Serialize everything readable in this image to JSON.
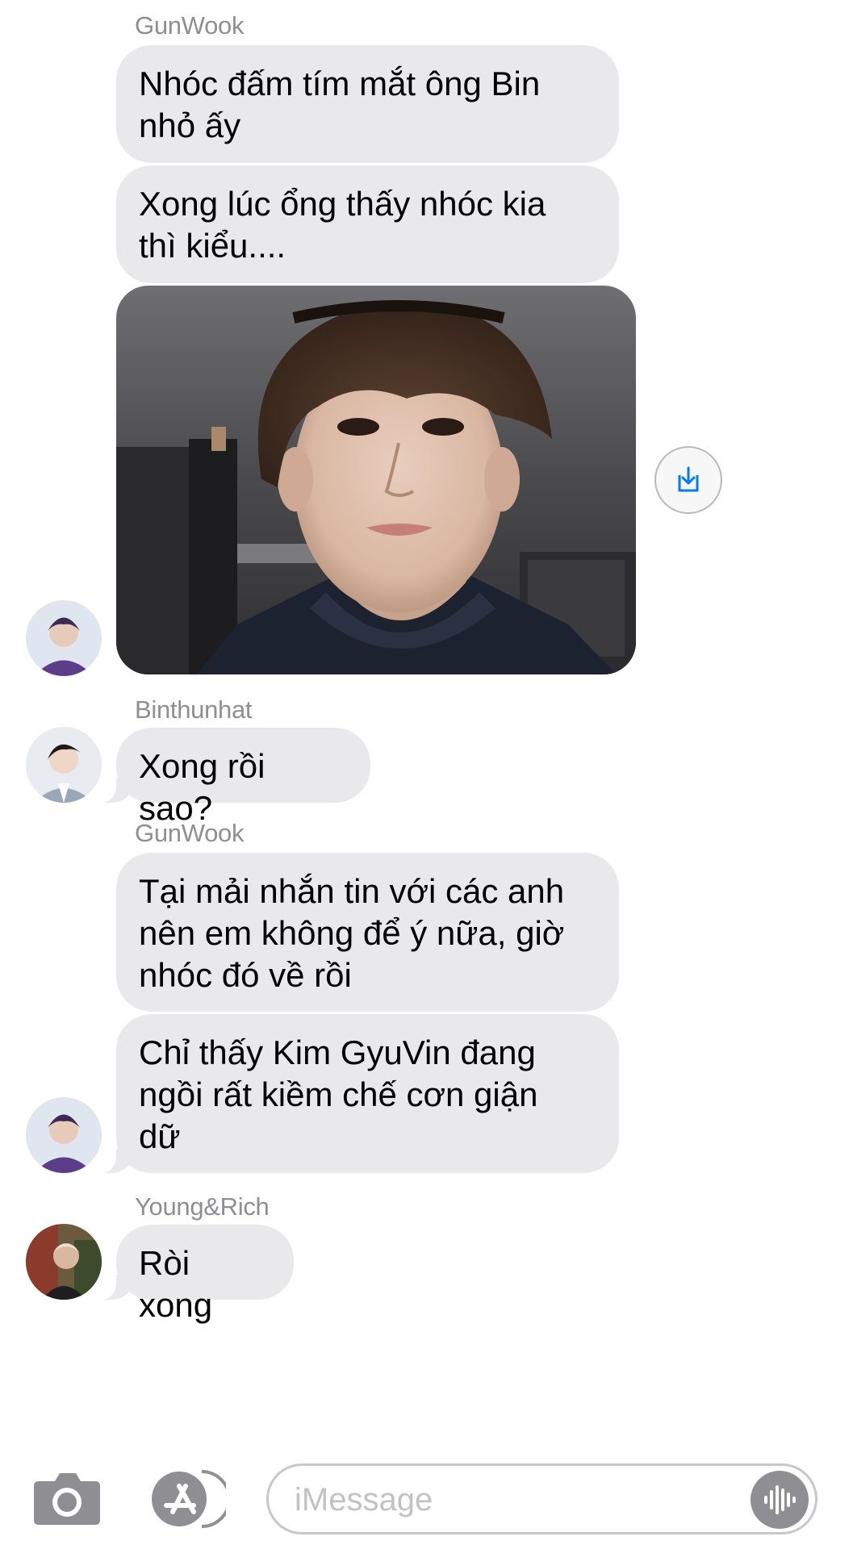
{
  "messages": {
    "group1": {
      "sender": "GunWook",
      "bubble1": [
        "Nhóc đấm tím mắt ông Bin",
        "nhỏ ấy"
      ],
      "bubble2": [
        "Xong lúc ổng thấy nhóc kia",
        "thì kiểu...."
      ]
    },
    "group2": {
      "sender": "Binthunhat",
      "bubble1": [
        "Xong rồi sao?"
      ]
    },
    "group3": {
      "sender": "GunWook",
      "bubble1": [
        "Tại mải nhắn tin với các anh",
        "nên em không để ý nữa, giờ",
        "nhóc đó về rồi"
      ],
      "bubble2": [
        "Chỉ thấy Kim GyuVin đang",
        "ngồi rất kiềm chế cơn giận",
        "dữ"
      ]
    },
    "group4": {
      "sender": "Young&Rich",
      "bubble1": [
        "Ròi xong"
      ]
    }
  },
  "icons": {
    "save": "download-icon",
    "camera": "camera-icon",
    "apps": "app-store-icon",
    "audio": "audio-waveform-icon"
  },
  "input": {
    "placeholder": "iMessage",
    "value": ""
  },
  "colors": {
    "bubble_incoming": "#e9e9eb",
    "sender_name": "#8e8e93",
    "accent": "#007aff",
    "toolbar_icon": "#8e8e93"
  }
}
